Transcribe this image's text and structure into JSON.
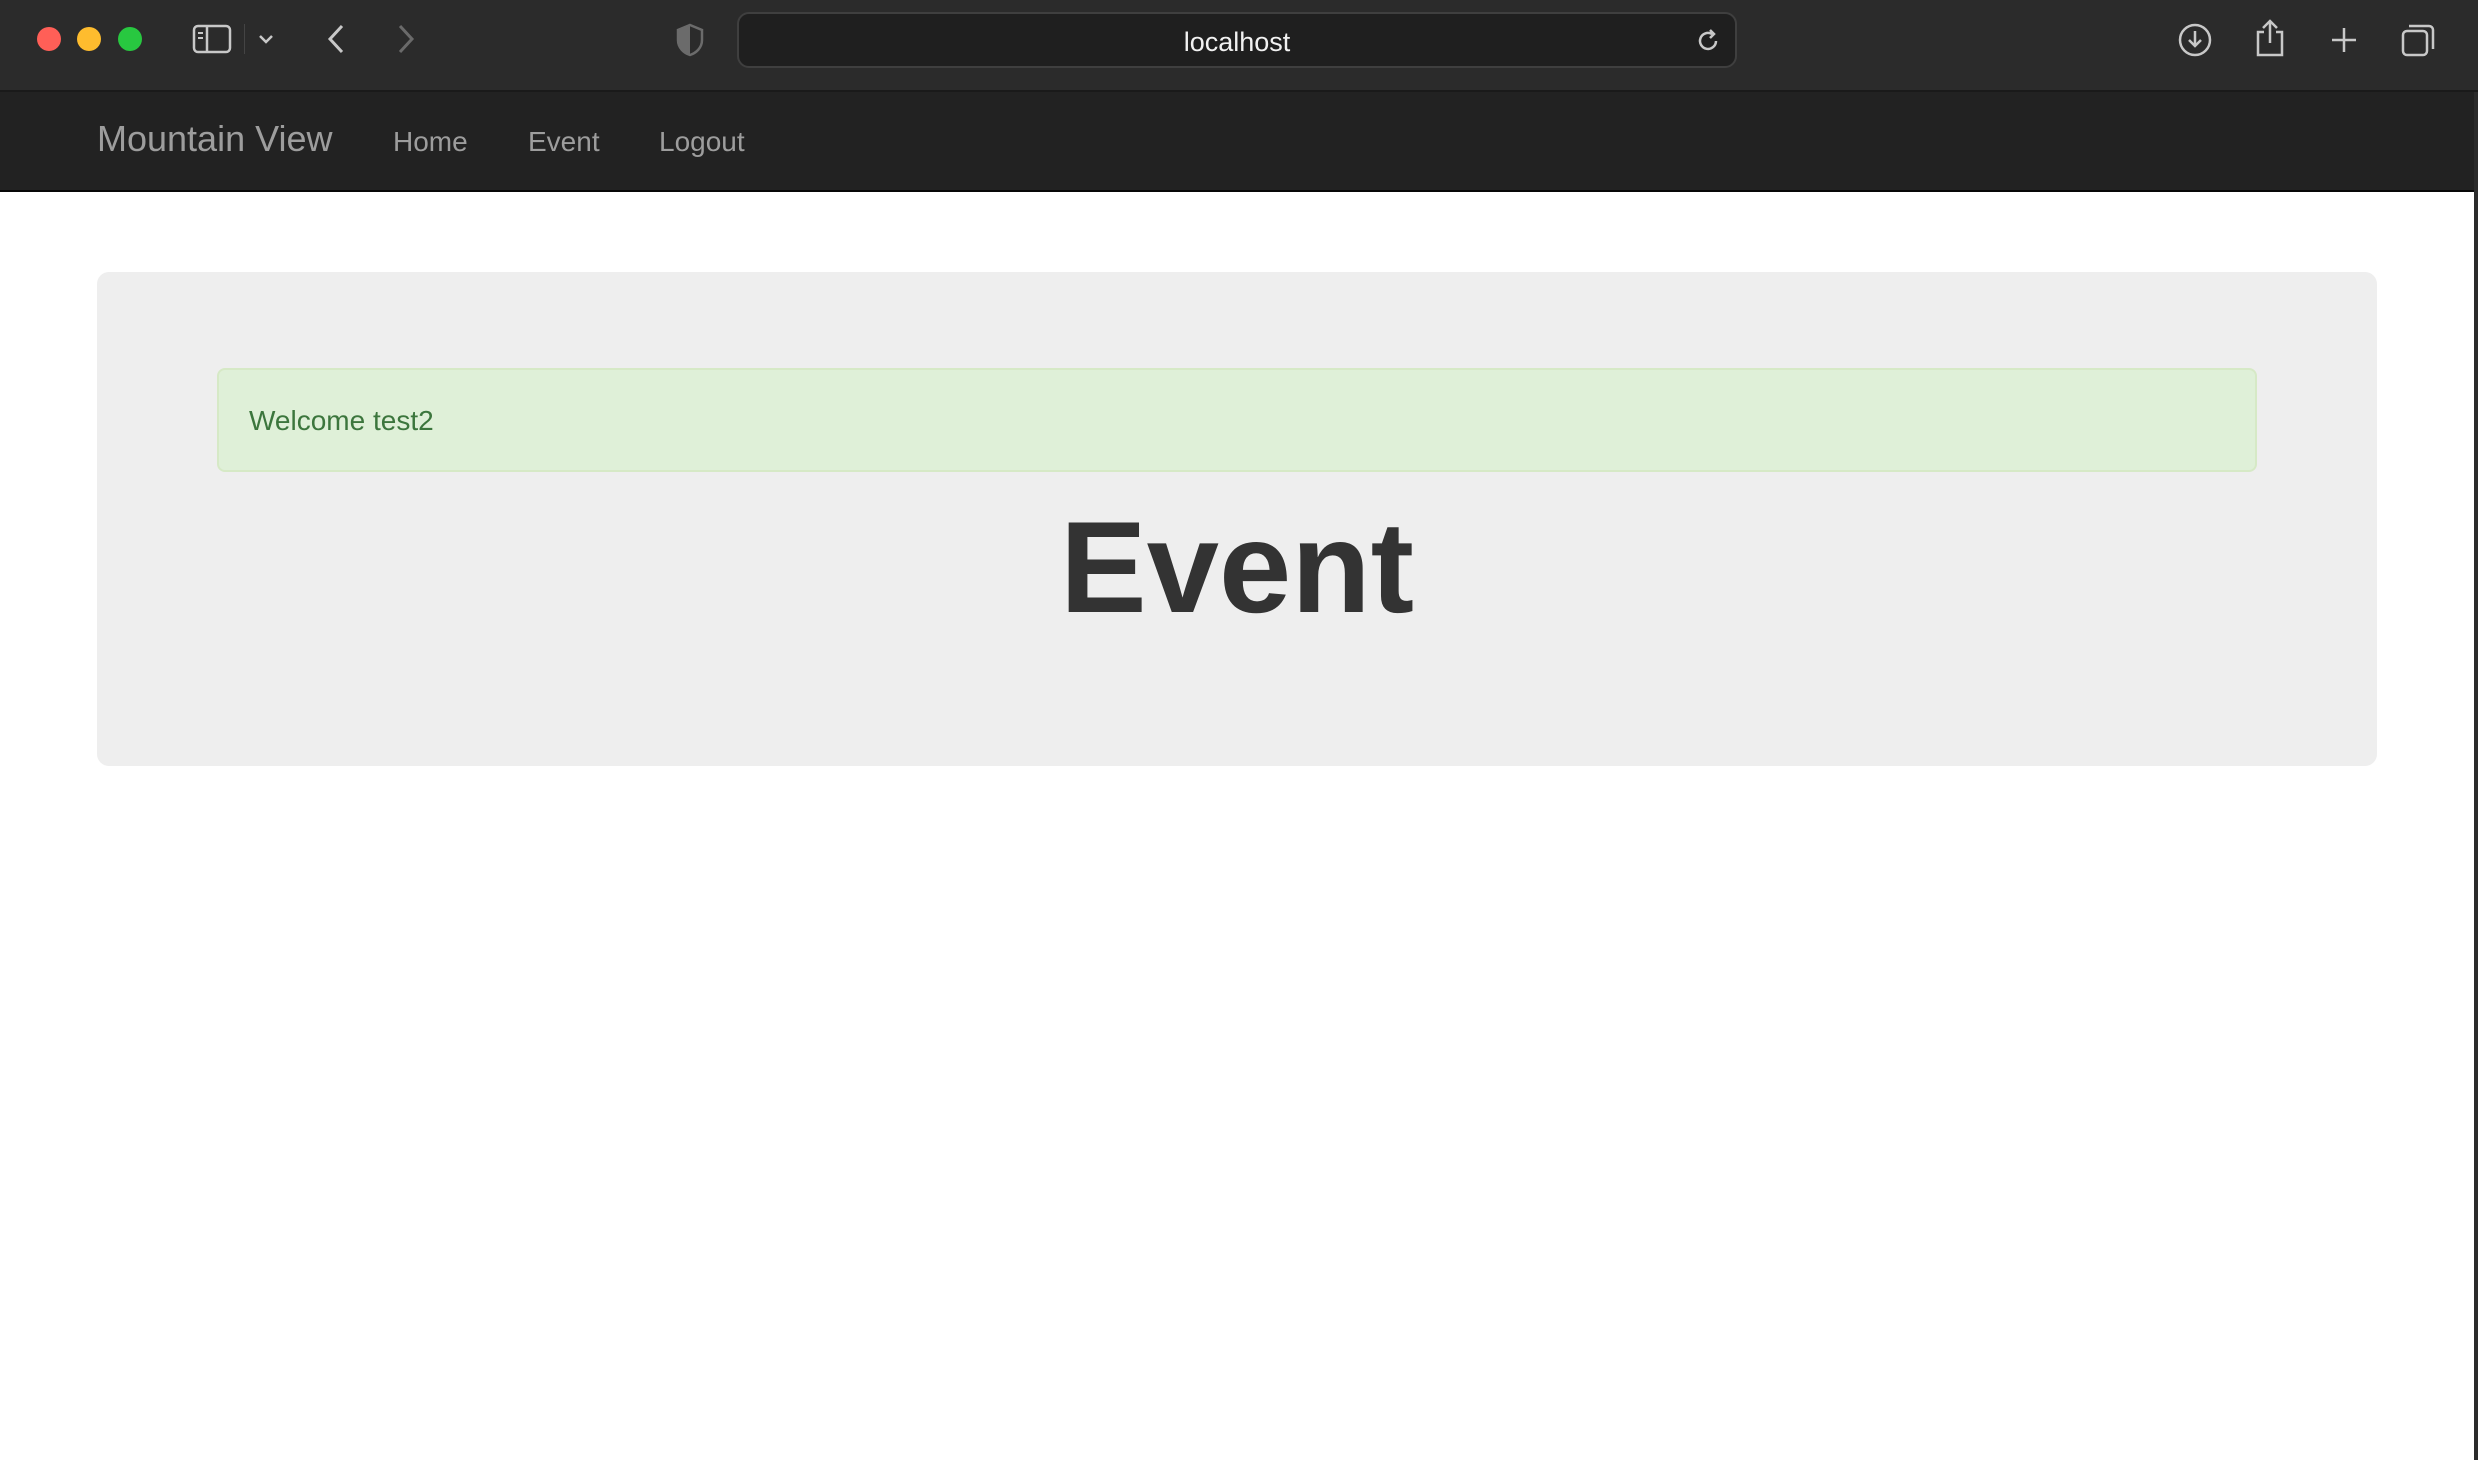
{
  "browser": {
    "url": "localhost",
    "icons": [
      "sidebar-icon",
      "chevron-down-icon",
      "back-arrow-icon",
      "forward-arrow-icon",
      "shield-icon",
      "reload-icon",
      "download-icon",
      "share-icon",
      "plus-icon",
      "tabs-icon"
    ]
  },
  "navbar": {
    "brand": "Mountain View",
    "links": [
      "Home",
      "Event",
      "Logout"
    ]
  },
  "main": {
    "alert": "Welcome test2",
    "title": "Event"
  },
  "colors": {
    "navbar_bg": "#222222",
    "nav_text": "#9d9d9d",
    "jumbotron_bg": "#eeeeee",
    "alert_bg": "#dff0d8",
    "alert_text": "#3c763d",
    "title_text": "#333333"
  }
}
